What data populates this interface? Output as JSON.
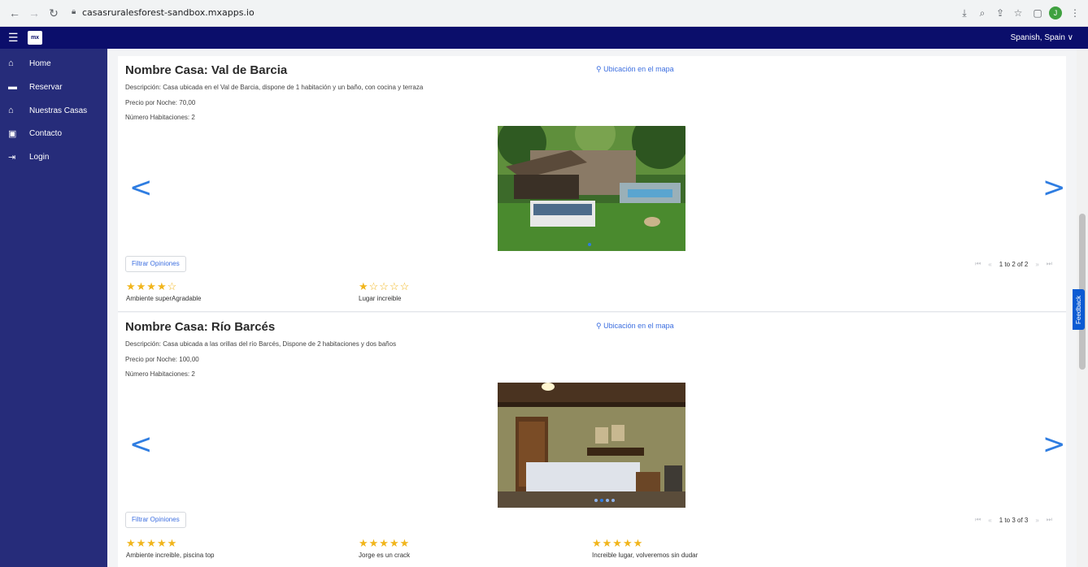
{
  "browser": {
    "url": "casasruralesforest-sandbox.mxapps.io",
    "profile_initial": "J"
  },
  "appbar": {
    "logo": "mx",
    "language": "Spanish, Spain ∨"
  },
  "sidebar": {
    "items": [
      {
        "label": "Home",
        "icon": "home-icon"
      },
      {
        "label": "Reservar",
        "icon": "bed-icon"
      },
      {
        "label": "Nuestras Casas",
        "icon": "house-icon"
      },
      {
        "label": "Contacto",
        "icon": "contact-card-icon"
      },
      {
        "label": "Login",
        "icon": "login-icon"
      }
    ]
  },
  "houses": [
    {
      "title": "Nombre Casa: Val de Barcia",
      "map_link": "Ubicación en el mapa",
      "description": "Descripción: Casa ubicada en el Val de Barcia, dispone de 1 habitación y un baño, con cocina y terraza",
      "price": "Precio por Noche: 70,00",
      "rooms": "Número Habitaciones: 2",
      "filter_label": "Filtrar Opiniones",
      "pager": "1 to 2 of 2",
      "reviews": [
        {
          "stars": 4,
          "text": "Ambiente superAgradable"
        },
        {
          "stars": 1,
          "text": "Lugar increible"
        }
      ]
    },
    {
      "title": "Nombre Casa: Río Barcés",
      "map_link": "Ubicación en el mapa",
      "description": "Descripción: Casa ubicada a las orillas del río Barcés, Dispone de 2 habitaciones y dos baños",
      "price": "Precio por Noche: 100,00",
      "rooms": "Número Habitaciones: 2",
      "filter_label": "Filtrar Opiniones",
      "pager": "1 to 3 of 3",
      "reviews": [
        {
          "stars": 5,
          "text": "Ambiente increible, piscina top"
        },
        {
          "stars": 5,
          "text": "Jorge es un crack"
        },
        {
          "stars": 5,
          "text": "Increible lugar, volveremos sin dudar"
        }
      ]
    }
  ],
  "feedback_label": "Feedback",
  "colors": {
    "appbar": "#0b0e6b",
    "sidebar": "#262c7a",
    "accent": "#2f7de1",
    "star": "#f1b51c"
  }
}
